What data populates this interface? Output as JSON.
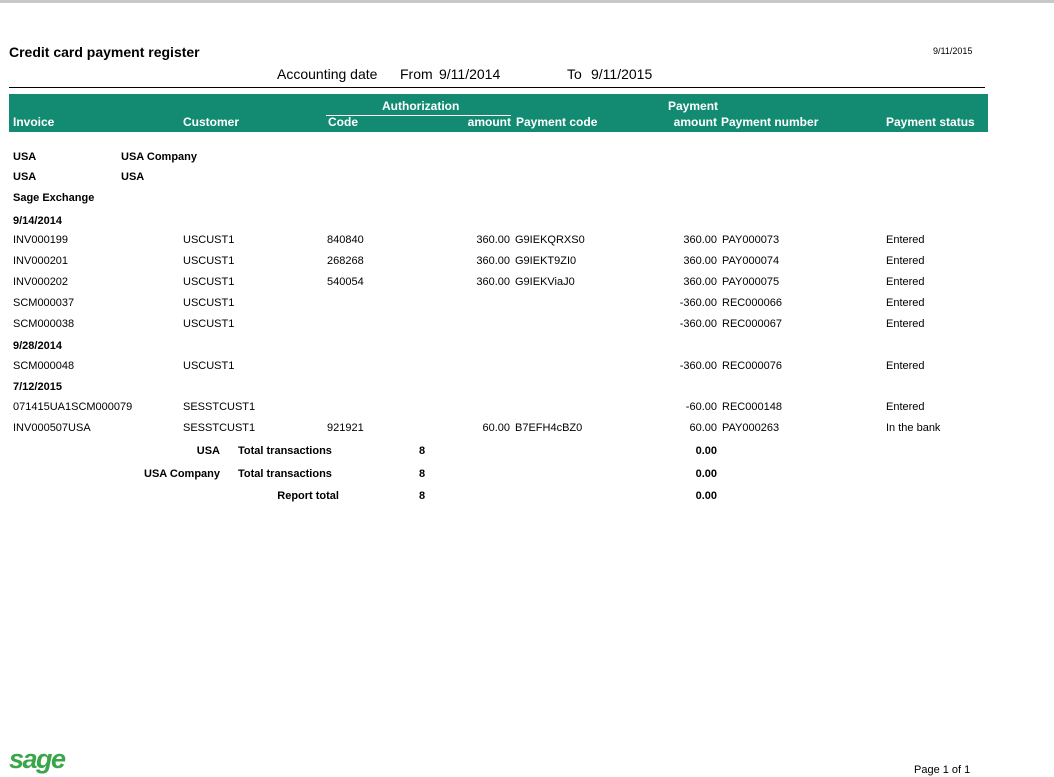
{
  "report": {
    "title": "Credit card payment register",
    "run_date": "9/11/2015",
    "date_label": "Accounting date",
    "from_label": "From",
    "from_date": "9/11/2014",
    "to_label": "To",
    "to_date": "9/11/2015"
  },
  "header": {
    "invoice": "Invoice",
    "customer": "Customer",
    "authorization": "Authorization",
    "code": "Code",
    "amount": "amount",
    "payment_code": "Payment code",
    "payment": "Payment",
    "payment_amount": "amount",
    "payment_number": "Payment number",
    "payment_status": "Payment status"
  },
  "groups": {
    "g1_a": "USA",
    "g1_b": "USA Company",
    "g2_a": "USA",
    "g2_b": "USA",
    "g3": "Sage Exchange"
  },
  "dates": [
    "9/14/2014",
    "9/28/2014",
    "7/12/2015"
  ],
  "rows": [
    {
      "invoice": "INV000199",
      "customer": "USCUST1",
      "code": "840840",
      "auth_amount": "360.00",
      "payment_code": "G9IEKQRXS0",
      "payment_amount": "360.00",
      "payment_number": "PAY000073",
      "status": "Entered"
    },
    {
      "invoice": "INV000201",
      "customer": "USCUST1",
      "code": "268268",
      "auth_amount": "360.00",
      "payment_code": "G9IEKT9ZI0",
      "payment_amount": "360.00",
      "payment_number": "PAY000074",
      "status": "Entered"
    },
    {
      "invoice": "INV000202",
      "customer": "USCUST1",
      "code": "540054",
      "auth_amount": "360.00",
      "payment_code": "G9IEKViaJ0",
      "payment_amount": "360.00",
      "payment_number": "PAY000075",
      "status": "Entered"
    },
    {
      "invoice": "SCM000037",
      "customer": "USCUST1",
      "code": "",
      "auth_amount": "",
      "payment_code": "",
      "payment_amount": "-360.00",
      "payment_number": "REC000066",
      "status": "Entered"
    },
    {
      "invoice": "SCM000038",
      "customer": "USCUST1",
      "code": "",
      "auth_amount": "",
      "payment_code": "",
      "payment_amount": "-360.00",
      "payment_number": "REC000067",
      "status": "Entered"
    },
    {
      "invoice": "SCM000048",
      "customer": "USCUST1",
      "code": "",
      "auth_amount": "",
      "payment_code": "",
      "payment_amount": "-360.00",
      "payment_number": "REC000076",
      "status": "Entered"
    },
    {
      "invoice": "071415UA1SCM000079",
      "customer": "SESSTCUST1",
      "code": "",
      "auth_amount": "",
      "payment_code": "",
      "payment_amount": "-60.00",
      "payment_number": "REC000148",
      "status": "Entered"
    },
    {
      "invoice": "INV000507USA",
      "customer": "SESSTCUST1",
      "code": "921921",
      "auth_amount": "60.00",
      "payment_code": "B7EFH4cBZ0",
      "payment_amount": "60.00",
      "payment_number": "PAY000263",
      "status": "In the bank"
    }
  ],
  "totals": [
    {
      "group": "USA",
      "label": "Total transactions",
      "count": "8",
      "amount": "0.00"
    },
    {
      "group": "USA Company",
      "label": "Total transactions",
      "count": "8",
      "amount": "0.00"
    },
    {
      "group": "",
      "label": "Report total",
      "count": "8",
      "amount": "0.00"
    }
  ],
  "footer": {
    "logo": "sage",
    "page": "Page 1 of 1"
  }
}
